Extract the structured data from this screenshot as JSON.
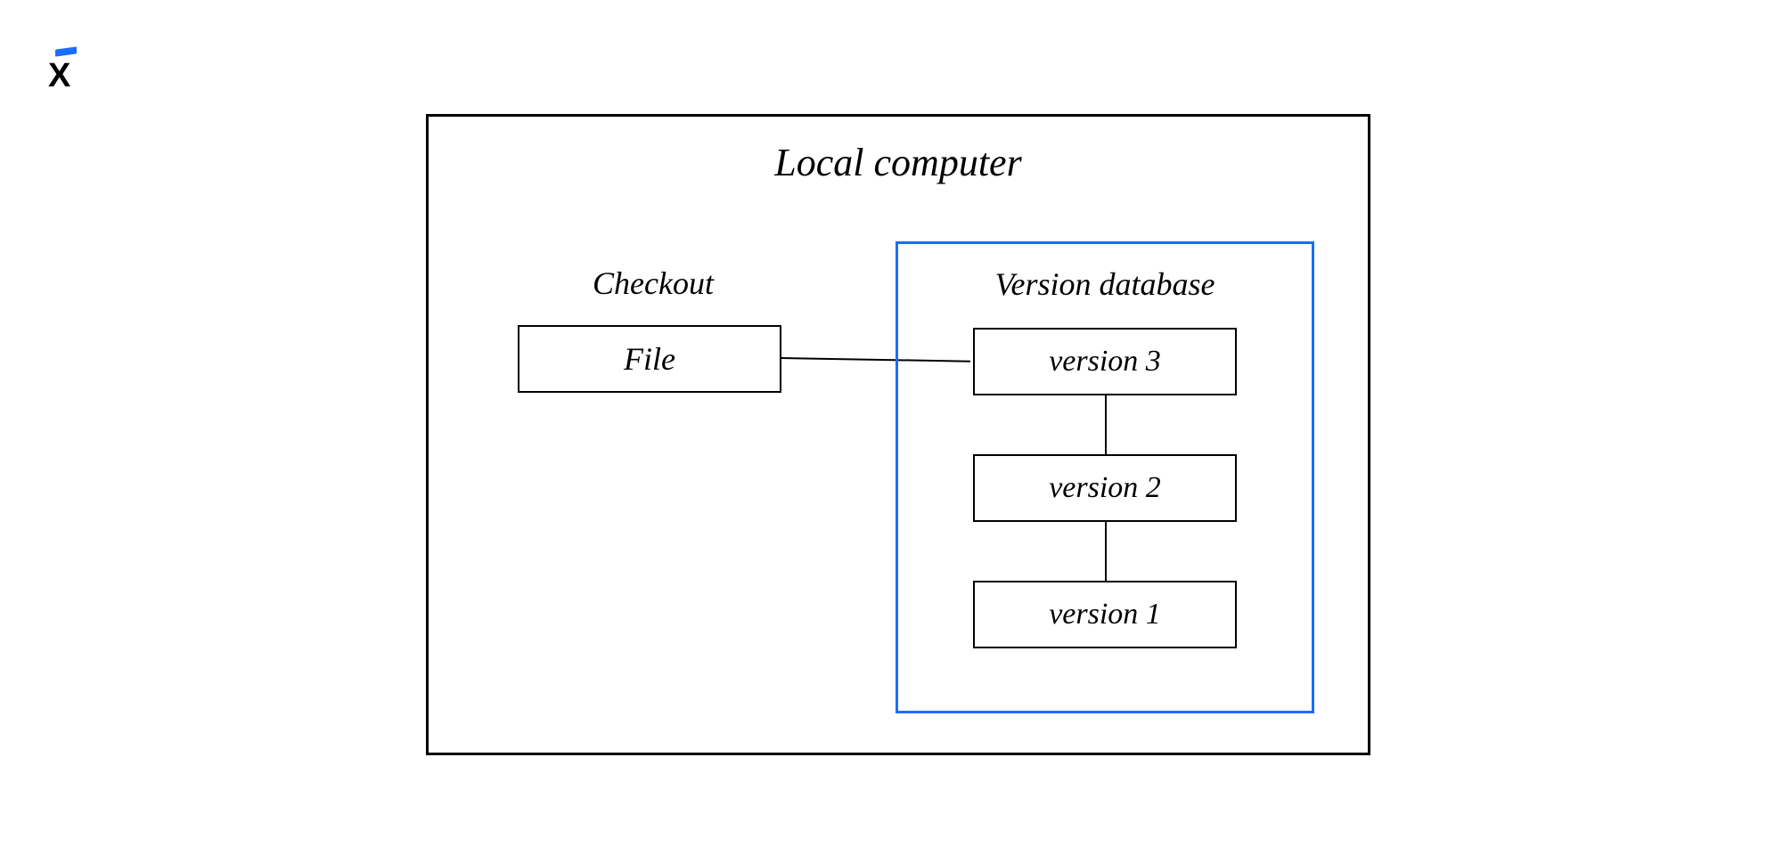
{
  "logo": {
    "letter": "X"
  },
  "diagram": {
    "title": "Local computer",
    "checkout": {
      "title": "Checkout",
      "file_label": "File"
    },
    "database": {
      "title": "Version database",
      "versions": [
        "version 3",
        "version 2",
        "version 1"
      ]
    },
    "colors": {
      "accent": "#1a6dff",
      "border": "#000000"
    }
  }
}
